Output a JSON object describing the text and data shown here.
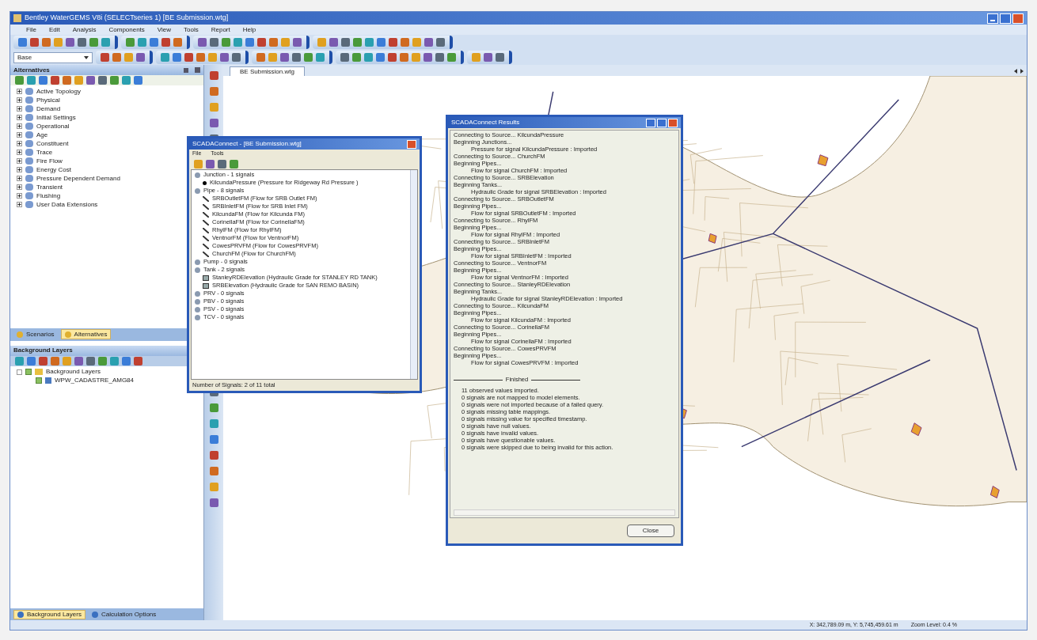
{
  "window": {
    "title": "Bentley WaterGEMS V8i (SELECTseries 1) [BE Submission.wtg]"
  },
  "menu": [
    "File",
    "Edit",
    "Analysis",
    "Components",
    "View",
    "Tools",
    "Report",
    "Help"
  ],
  "scenario_dropdown": {
    "value": "Base"
  },
  "alternatives_panel": {
    "title": "Alternatives",
    "items": [
      {
        "label": "Active Topology",
        "expanded": false
      },
      {
        "label": "Physical",
        "expanded": false
      },
      {
        "label": "Demand",
        "expanded": false
      },
      {
        "label": "Initial Settings",
        "expanded": false
      },
      {
        "label": "Operational",
        "expanded": false
      },
      {
        "label": "Age",
        "expanded": false
      },
      {
        "label": "Constituent",
        "expanded": false
      },
      {
        "label": "Trace",
        "expanded": false
      },
      {
        "label": "Fire Flow",
        "expanded": false
      },
      {
        "label": "Energy Cost",
        "expanded": false
      },
      {
        "label": "Pressure Dependent Demand",
        "expanded": false
      },
      {
        "label": "Transient",
        "expanded": false
      },
      {
        "label": "Flushing",
        "expanded": false
      },
      {
        "label": "User Data Extensions",
        "expanded": false
      }
    ]
  },
  "panel_tabs": [
    {
      "label": "Scenarios",
      "selected": false
    },
    {
      "label": "Alternatives",
      "selected": true
    }
  ],
  "background_layers_panel": {
    "title": "Background Layers",
    "items": [
      {
        "label": "Background Layers",
        "checked": true,
        "children": [
          {
            "label": "WPW_CADASTRE_AMG84",
            "checked": true
          }
        ]
      }
    ]
  },
  "bottom_tabs": [
    {
      "label": "Background Layers",
      "selected": true
    },
    {
      "label": "Calculation Options",
      "selected": false
    }
  ],
  "document_tab": {
    "label": "BE Submission.wtg"
  },
  "scada_dialog": {
    "title": "SCADAConnect - [BE Submission.wtg]",
    "menu": [
      "File",
      "Tools"
    ],
    "groups": [
      {
        "label": "Junction - 1 signals",
        "children": [
          {
            "kind": "junction",
            "label": "KilcundaPressure (Pressure for Ridgeway Rd Pressure )"
          }
        ]
      },
      {
        "label": "Pipe - 8 signals",
        "children": [
          {
            "kind": "pipe",
            "label": "SRBOutletFM (Flow for SRB Outlet FM)"
          },
          {
            "kind": "pipe",
            "label": "SRBInletFM (Flow for SRB Inlet FM)"
          },
          {
            "kind": "pipe",
            "label": "KilcundaFM (Flow for Kilcunda FM)"
          },
          {
            "kind": "pipe",
            "label": "CorinellaFM (Flow for CorinellaFM)"
          },
          {
            "kind": "pipe",
            "label": "RhylFM (Flow for RhylFM)"
          },
          {
            "kind": "pipe",
            "label": "VentnorFM (Flow for VentnorFM)"
          },
          {
            "kind": "pipe",
            "label": "CowesPRVFM (Flow for CowesPRVFM)"
          },
          {
            "kind": "pipe",
            "label": "ChurchFM (Flow for ChurchFM)"
          }
        ]
      },
      {
        "label": "Pump - 0 signals"
      },
      {
        "label": "Tank - 2 signals",
        "children": [
          {
            "kind": "tank",
            "label": "StanleyRDElevation (Hydraulic Grade for STANLEY RD TANK)"
          },
          {
            "kind": "tank",
            "label": "SRBElevation (Hydraulic Grade for SAN REMO BASIN)"
          }
        ]
      },
      {
        "label": "PRV - 0 signals"
      },
      {
        "label": "PBV - 0 signals"
      },
      {
        "label": "PSV - 0 signals"
      },
      {
        "label": "TCV - 0 signals"
      }
    ],
    "status": "Number of Signals: 2 of 11 total"
  },
  "results_dialog": {
    "title": "SCADAConnect Results",
    "lines": [
      {
        "kind": "step",
        "text": "Connecting to Source... KilcundaPressure"
      },
      {
        "kind": "step",
        "text": "Beginning Junctions..."
      },
      {
        "kind": "detail",
        "text": "Pressure for signal KilcundaPressure : Imported"
      },
      {
        "kind": "step",
        "text": "Connecting to Source... ChurchFM"
      },
      {
        "kind": "step",
        "text": "Beginning Pipes..."
      },
      {
        "kind": "detail",
        "text": "Flow for signal ChurchFM : Imported"
      },
      {
        "kind": "step",
        "text": "Connecting to Source... SRBElevation"
      },
      {
        "kind": "step",
        "text": "Beginning Tanks..."
      },
      {
        "kind": "detail",
        "text": "Hydraulic Grade for signal SRBElevation : Imported"
      },
      {
        "kind": "step",
        "text": "Connecting to Source... SRBOutletFM"
      },
      {
        "kind": "step",
        "text": "Beginning Pipes..."
      },
      {
        "kind": "detail",
        "text": "Flow for signal SRBOutletFM : Imported"
      },
      {
        "kind": "step",
        "text": "Connecting to Source... RhylFM"
      },
      {
        "kind": "step",
        "text": "Beginning Pipes..."
      },
      {
        "kind": "detail",
        "text": "Flow for signal RhylFM : Imported"
      },
      {
        "kind": "step",
        "text": "Connecting to Source... SRBInletFM"
      },
      {
        "kind": "step",
        "text": "Beginning Pipes..."
      },
      {
        "kind": "detail",
        "text": "Flow for signal SRBInletFM : Imported"
      },
      {
        "kind": "step",
        "text": "Connecting to Source... VentnorFM"
      },
      {
        "kind": "step",
        "text": "Beginning Pipes..."
      },
      {
        "kind": "detail",
        "text": "Flow for signal VentnorFM : Imported"
      },
      {
        "kind": "step",
        "text": "Connecting to Source... StanleyRDElevation"
      },
      {
        "kind": "step",
        "text": "Beginning Tanks..."
      },
      {
        "kind": "detail",
        "text": "Hydraulic Grade for signal StanleyRDElevation : Imported"
      },
      {
        "kind": "step",
        "text": "Connecting to Source... KilcundaFM"
      },
      {
        "kind": "step",
        "text": "Beginning Pipes..."
      },
      {
        "kind": "detail",
        "text": "Flow for signal KilcundaFM : Imported"
      },
      {
        "kind": "step",
        "text": "Connecting to Source... CorinellaFM"
      },
      {
        "kind": "step",
        "text": "Beginning Pipes..."
      },
      {
        "kind": "detail",
        "text": "Flow for signal CorinellaFM : Imported"
      },
      {
        "kind": "step",
        "text": "Connecting to Source... CowesPRVFM"
      },
      {
        "kind": "step",
        "text": "Beginning Pipes..."
      },
      {
        "kind": "detail",
        "text": "Flow for signal CowesPRVFM : Imported"
      },
      {
        "kind": "heading",
        "text": "Finished"
      },
      {
        "kind": "summary",
        "text": "11 observed values imported."
      },
      {
        "kind": "summary",
        "text": "0 signals are not mapped to model elements."
      },
      {
        "kind": "summary",
        "text": "0 signals were not imported because of a failed query."
      },
      {
        "kind": "summary",
        "text": "0 signals missing table mappings."
      },
      {
        "kind": "summary",
        "text": "0 signals missing value for specified timestamp."
      },
      {
        "kind": "summary",
        "text": "0 signals have null values."
      },
      {
        "kind": "summary",
        "text": "0 signals have invalid values."
      },
      {
        "kind": "summary",
        "text": "0 signals have questionable values."
      },
      {
        "kind": "summary",
        "text": "0 signals were skipped due to being invalid for this action."
      }
    ],
    "button": "Close"
  },
  "status_bar": {
    "coordinates": "X: 342,789.09 m, Y: 5,745,459.61 m",
    "zoom": "Zoom Level: 0.4 %"
  }
}
